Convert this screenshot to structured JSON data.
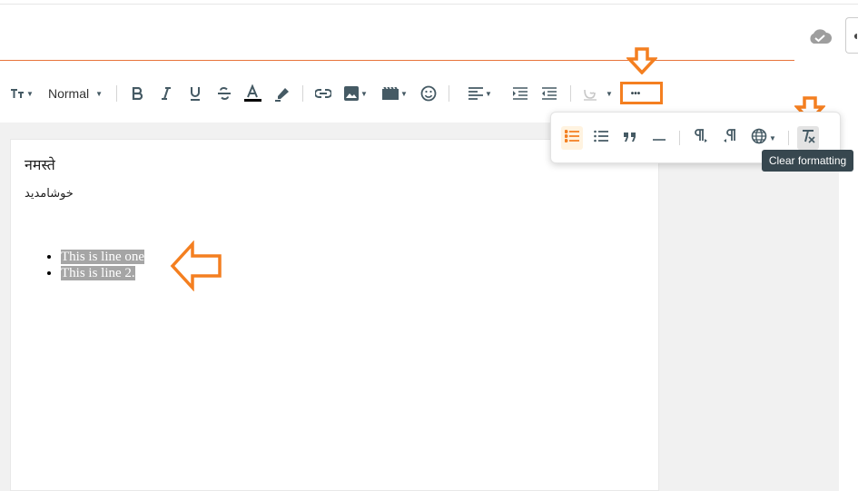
{
  "toolbar": {
    "text_style_icon": "text-size-icon",
    "block_format_value": "Normal",
    "buttons": [
      "bold-icon",
      "italic-icon",
      "underline-icon",
      "strikethrough-icon",
      "font-color-icon",
      "highlight-icon",
      "link-icon",
      "image-icon",
      "video-icon",
      "emoji-icon",
      "align-left-icon",
      "indent-icon",
      "outdent-icon",
      "transliterate-icon",
      "more-icon"
    ],
    "more_label": "•••"
  },
  "status": {
    "saved_icon": "cloud-check-icon"
  },
  "editor": {
    "line1": "नमस्ते",
    "line2": "خوشامدید",
    "bullets": [
      "This is line one",
      "This is line 2."
    ]
  },
  "more_menu": {
    "buttons": [
      "bulleted-list-icon",
      "numbered-list-icon",
      "quote-icon",
      "horizontal-rule-icon",
      "ltr-icon",
      "rtl-icon",
      "language-icon",
      "clear-formatting-icon"
    ]
  },
  "tooltip": {
    "text": "Clear formatting"
  },
  "colors": {
    "accent": "#f47f20",
    "title_underline": "#e8743b",
    "tooltip_bg": "#37474f",
    "selection_bg": "#a5a5a5"
  }
}
